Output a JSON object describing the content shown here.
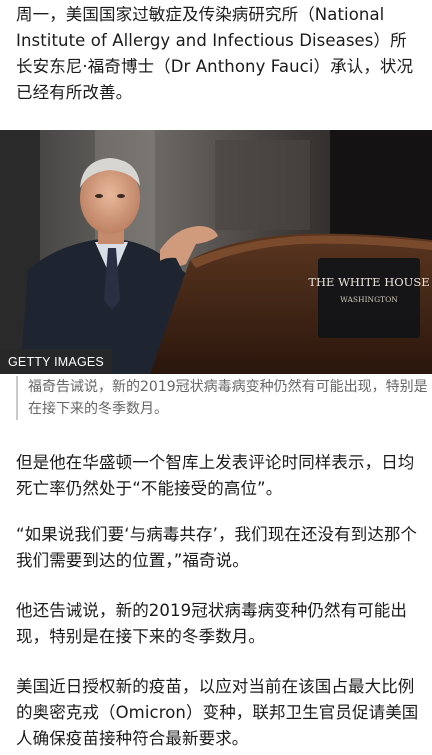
{
  "article": {
    "intro": "周一，美国国家过敏症及传染病研究所（National Institute of Allergy and Infectious Diseases）所长安东尼·福奇博士（Dr Anthony Fauci）承认，状况已经有所改善。",
    "image": {
      "credit": "GETTY IMAGES",
      "podium_sign_line1": "THE WHITE HOUSE",
      "podium_sign_line2": "WASHINGTON",
      "caption": "福奇告诫说，新的2019冠状病毒病变种仍然有可能出现，特别是在接下来的冬季数月。"
    },
    "paragraphs": [
      "但是他在华盛顿一个智库上发表评论时同样表示，日均死亡率仍然处于“不能接受的高位”。",
      "“如果说我们要‘与病毒共存’，我们现在还没有到达那个我们需要到达的位置，”福奇说。",
      "他还告诫说，新的2019冠状病毒病变种仍然有可能出现，特别是在接下来的冬季数月。",
      "美国近日授权新的疫苗，以应对当前在该国占最大比例的奥密克戎（Omicron）变种，联邦卫生官员促请美国人确保疫苗接种符合最新要求。"
    ]
  }
}
